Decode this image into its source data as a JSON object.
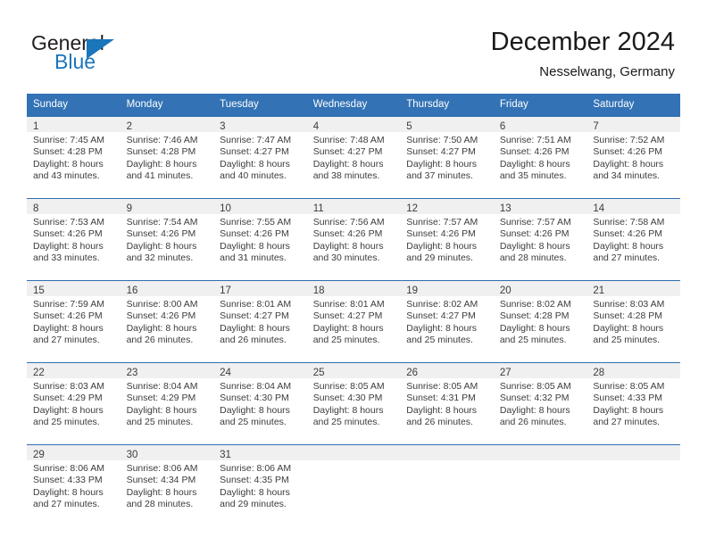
{
  "brand": {
    "name_part1": "General",
    "name_part2": "Blue",
    "accent_color": "#1b75bb"
  },
  "header": {
    "title": "December 2024",
    "subtitle": "Nesselwang, Germany"
  },
  "theme": {
    "header_row_color": "#3272b5",
    "daynum_band_color": "#f0f0f0",
    "text_color": "#3c3c3c"
  },
  "calendar": {
    "weekday_headers": [
      "Sunday",
      "Monday",
      "Tuesday",
      "Wednesday",
      "Thursday",
      "Friday",
      "Saturday"
    ],
    "weeks": [
      [
        {
          "day": "1",
          "sunrise": "Sunrise: 7:45 AM",
          "sunset": "Sunset: 4:28 PM",
          "daylight_line1": "Daylight: 8 hours",
          "daylight_line2": "and 43 minutes."
        },
        {
          "day": "2",
          "sunrise": "Sunrise: 7:46 AM",
          "sunset": "Sunset: 4:28 PM",
          "daylight_line1": "Daylight: 8 hours",
          "daylight_line2": "and 41 minutes."
        },
        {
          "day": "3",
          "sunrise": "Sunrise: 7:47 AM",
          "sunset": "Sunset: 4:27 PM",
          "daylight_line1": "Daylight: 8 hours",
          "daylight_line2": "and 40 minutes."
        },
        {
          "day": "4",
          "sunrise": "Sunrise: 7:48 AM",
          "sunset": "Sunset: 4:27 PM",
          "daylight_line1": "Daylight: 8 hours",
          "daylight_line2": "and 38 minutes."
        },
        {
          "day": "5",
          "sunrise": "Sunrise: 7:50 AM",
          "sunset": "Sunset: 4:27 PM",
          "daylight_line1": "Daylight: 8 hours",
          "daylight_line2": "and 37 minutes."
        },
        {
          "day": "6",
          "sunrise": "Sunrise: 7:51 AM",
          "sunset": "Sunset: 4:26 PM",
          "daylight_line1": "Daylight: 8 hours",
          "daylight_line2": "and 35 minutes."
        },
        {
          "day": "7",
          "sunrise": "Sunrise: 7:52 AM",
          "sunset": "Sunset: 4:26 PM",
          "daylight_line1": "Daylight: 8 hours",
          "daylight_line2": "and 34 minutes."
        }
      ],
      [
        {
          "day": "8",
          "sunrise": "Sunrise: 7:53 AM",
          "sunset": "Sunset: 4:26 PM",
          "daylight_line1": "Daylight: 8 hours",
          "daylight_line2": "and 33 minutes."
        },
        {
          "day": "9",
          "sunrise": "Sunrise: 7:54 AM",
          "sunset": "Sunset: 4:26 PM",
          "daylight_line1": "Daylight: 8 hours",
          "daylight_line2": "and 32 minutes."
        },
        {
          "day": "10",
          "sunrise": "Sunrise: 7:55 AM",
          "sunset": "Sunset: 4:26 PM",
          "daylight_line1": "Daylight: 8 hours",
          "daylight_line2": "and 31 minutes."
        },
        {
          "day": "11",
          "sunrise": "Sunrise: 7:56 AM",
          "sunset": "Sunset: 4:26 PM",
          "daylight_line1": "Daylight: 8 hours",
          "daylight_line2": "and 30 minutes."
        },
        {
          "day": "12",
          "sunrise": "Sunrise: 7:57 AM",
          "sunset": "Sunset: 4:26 PM",
          "daylight_line1": "Daylight: 8 hours",
          "daylight_line2": "and 29 minutes."
        },
        {
          "day": "13",
          "sunrise": "Sunrise: 7:57 AM",
          "sunset": "Sunset: 4:26 PM",
          "daylight_line1": "Daylight: 8 hours",
          "daylight_line2": "and 28 minutes."
        },
        {
          "day": "14",
          "sunrise": "Sunrise: 7:58 AM",
          "sunset": "Sunset: 4:26 PM",
          "daylight_line1": "Daylight: 8 hours",
          "daylight_line2": "and 27 minutes."
        }
      ],
      [
        {
          "day": "15",
          "sunrise": "Sunrise: 7:59 AM",
          "sunset": "Sunset: 4:26 PM",
          "daylight_line1": "Daylight: 8 hours",
          "daylight_line2": "and 27 minutes."
        },
        {
          "day": "16",
          "sunrise": "Sunrise: 8:00 AM",
          "sunset": "Sunset: 4:26 PM",
          "daylight_line1": "Daylight: 8 hours",
          "daylight_line2": "and 26 minutes."
        },
        {
          "day": "17",
          "sunrise": "Sunrise: 8:01 AM",
          "sunset": "Sunset: 4:27 PM",
          "daylight_line1": "Daylight: 8 hours",
          "daylight_line2": "and 26 minutes."
        },
        {
          "day": "18",
          "sunrise": "Sunrise: 8:01 AM",
          "sunset": "Sunset: 4:27 PM",
          "daylight_line1": "Daylight: 8 hours",
          "daylight_line2": "and 25 minutes."
        },
        {
          "day": "19",
          "sunrise": "Sunrise: 8:02 AM",
          "sunset": "Sunset: 4:27 PM",
          "daylight_line1": "Daylight: 8 hours",
          "daylight_line2": "and 25 minutes."
        },
        {
          "day": "20",
          "sunrise": "Sunrise: 8:02 AM",
          "sunset": "Sunset: 4:28 PM",
          "daylight_line1": "Daylight: 8 hours",
          "daylight_line2": "and 25 minutes."
        },
        {
          "day": "21",
          "sunrise": "Sunrise: 8:03 AM",
          "sunset": "Sunset: 4:28 PM",
          "daylight_line1": "Daylight: 8 hours",
          "daylight_line2": "and 25 minutes."
        }
      ],
      [
        {
          "day": "22",
          "sunrise": "Sunrise: 8:03 AM",
          "sunset": "Sunset: 4:29 PM",
          "daylight_line1": "Daylight: 8 hours",
          "daylight_line2": "and 25 minutes."
        },
        {
          "day": "23",
          "sunrise": "Sunrise: 8:04 AM",
          "sunset": "Sunset: 4:29 PM",
          "daylight_line1": "Daylight: 8 hours",
          "daylight_line2": "and 25 minutes."
        },
        {
          "day": "24",
          "sunrise": "Sunrise: 8:04 AM",
          "sunset": "Sunset: 4:30 PM",
          "daylight_line1": "Daylight: 8 hours",
          "daylight_line2": "and 25 minutes."
        },
        {
          "day": "25",
          "sunrise": "Sunrise: 8:05 AM",
          "sunset": "Sunset: 4:30 PM",
          "daylight_line1": "Daylight: 8 hours",
          "daylight_line2": "and 25 minutes."
        },
        {
          "day": "26",
          "sunrise": "Sunrise: 8:05 AM",
          "sunset": "Sunset: 4:31 PM",
          "daylight_line1": "Daylight: 8 hours",
          "daylight_line2": "and 26 minutes."
        },
        {
          "day": "27",
          "sunrise": "Sunrise: 8:05 AM",
          "sunset": "Sunset: 4:32 PM",
          "daylight_line1": "Daylight: 8 hours",
          "daylight_line2": "and 26 minutes."
        },
        {
          "day": "28",
          "sunrise": "Sunrise: 8:05 AM",
          "sunset": "Sunset: 4:33 PM",
          "daylight_line1": "Daylight: 8 hours",
          "daylight_line2": "and 27 minutes."
        }
      ],
      [
        {
          "day": "29",
          "sunrise": "Sunrise: 8:06 AM",
          "sunset": "Sunset: 4:33 PM",
          "daylight_line1": "Daylight: 8 hours",
          "daylight_line2": "and 27 minutes."
        },
        {
          "day": "30",
          "sunrise": "Sunrise: 8:06 AM",
          "sunset": "Sunset: 4:34 PM",
          "daylight_line1": "Daylight: 8 hours",
          "daylight_line2": "and 28 minutes."
        },
        {
          "day": "31",
          "sunrise": "Sunrise: 8:06 AM",
          "sunset": "Sunset: 4:35 PM",
          "daylight_line1": "Daylight: 8 hours",
          "daylight_line2": "and 29 minutes."
        },
        {
          "day": "",
          "sunrise": "",
          "sunset": "",
          "daylight_line1": "",
          "daylight_line2": ""
        },
        {
          "day": "",
          "sunrise": "",
          "sunset": "",
          "daylight_line1": "",
          "daylight_line2": ""
        },
        {
          "day": "",
          "sunrise": "",
          "sunset": "",
          "daylight_line1": "",
          "daylight_line2": ""
        },
        {
          "day": "",
          "sunrise": "",
          "sunset": "",
          "daylight_line1": "",
          "daylight_line2": ""
        }
      ]
    ]
  }
}
